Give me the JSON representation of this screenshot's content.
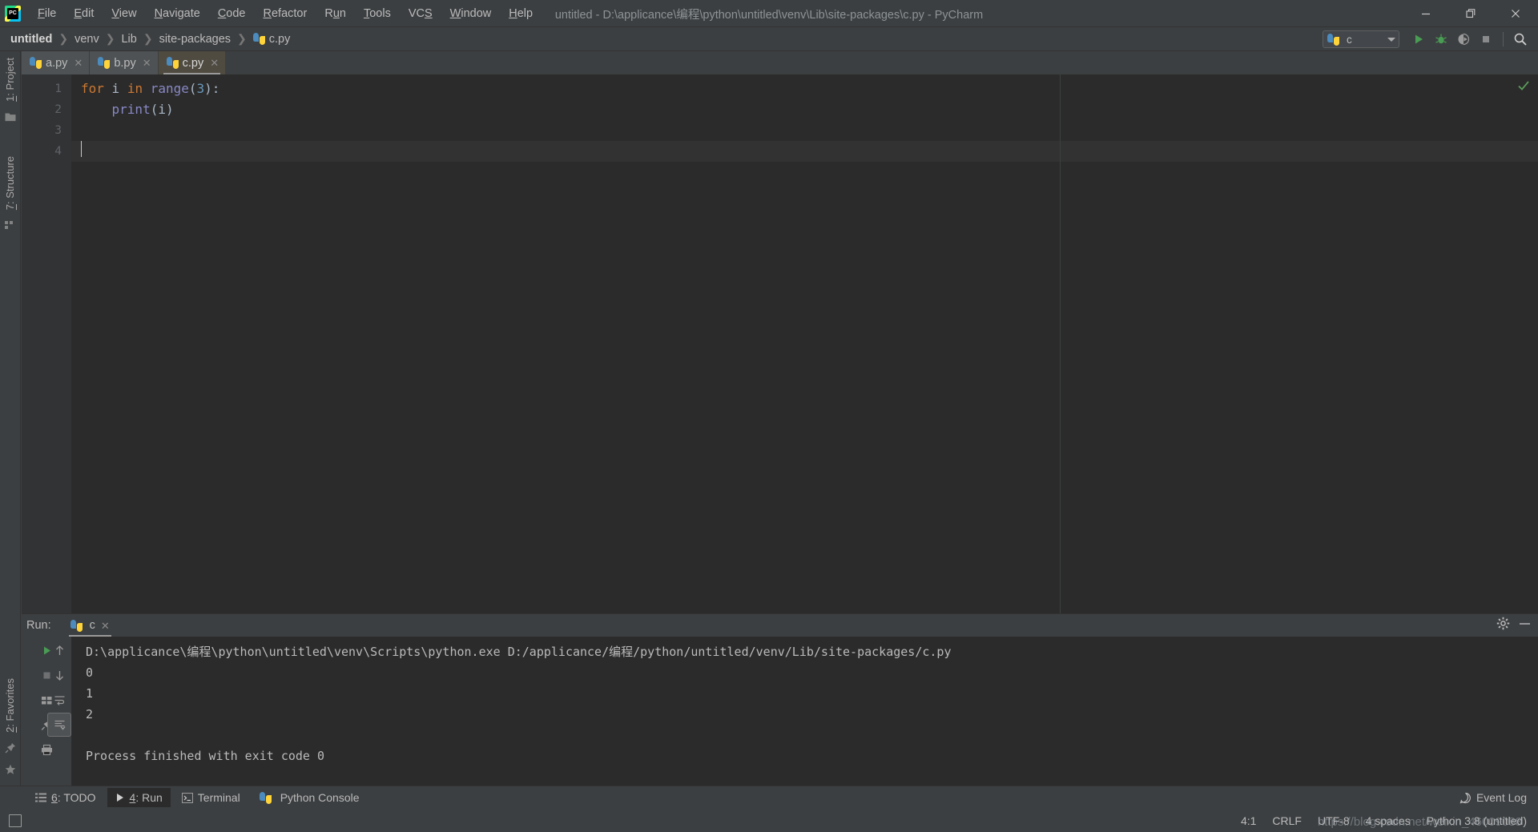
{
  "window": {
    "title": "untitled - D:\\applicance\\编程\\python\\untitled\\venv\\Lib\\site-packages\\c.py - PyCharm",
    "logo_text": "PC",
    "minimize": "—",
    "maximize": "❐",
    "close": "✕"
  },
  "menubar": {
    "items": [
      {
        "label": "File",
        "mnemonic": "F"
      },
      {
        "label": "Edit",
        "mnemonic": "E"
      },
      {
        "label": "View",
        "mnemonic": "V"
      },
      {
        "label": "Navigate",
        "mnemonic": "N"
      },
      {
        "label": "Code",
        "mnemonic": "C"
      },
      {
        "label": "Refactor",
        "mnemonic": "R"
      },
      {
        "label": "Run",
        "mnemonic": "u"
      },
      {
        "label": "Tools",
        "mnemonic": "T"
      },
      {
        "label": "VCS",
        "mnemonic": "S"
      },
      {
        "label": "Window",
        "mnemonic": "W"
      },
      {
        "label": "Help",
        "mnemonic": "H"
      }
    ]
  },
  "breadcrumb": {
    "separator": "❯",
    "items": [
      "untitled",
      "venv",
      "Lib",
      "site-packages",
      "c.py"
    ]
  },
  "toolbar": {
    "run_config": "c",
    "run_button": "run-icon",
    "debug_button": "debug-icon",
    "coverage_button": "run-with-coverage-icon",
    "stop_button": "stop-icon",
    "search_button": "search-icon"
  },
  "left_stripe": {
    "project_label": "1: Project",
    "structure_label": "7: Structure",
    "favorites_label": "2: Favorites"
  },
  "editor": {
    "tabs": [
      {
        "label": "a.py",
        "active": false
      },
      {
        "label": "b.py",
        "active": false
      },
      {
        "label": "c.py",
        "active": true
      }
    ],
    "line_numbers": [
      "1",
      "2",
      "3",
      "4"
    ],
    "code": [
      {
        "tokens": [
          {
            "t": "for",
            "c": "kw"
          },
          {
            "t": " i ",
            "c": "punc"
          },
          {
            "t": "in",
            "c": "kw"
          },
          {
            "t": " ",
            "c": "punc"
          },
          {
            "t": "range",
            "c": "builtin"
          },
          {
            "t": "(",
            "c": "punc"
          },
          {
            "t": "3",
            "c": "num"
          },
          {
            "t": "):",
            "c": "punc"
          }
        ]
      },
      {
        "tokens": [
          {
            "t": "    ",
            "c": "punc"
          },
          {
            "t": "print",
            "c": "builtin"
          },
          {
            "t": "(i)",
            "c": "punc"
          }
        ]
      },
      {
        "tokens": []
      },
      {
        "tokens": []
      }
    ]
  },
  "run_window": {
    "label": "Run:",
    "tab_name": "c",
    "settings_icon": "gear-icon",
    "minimize_icon": "minimize-icon",
    "sidebar_buttons": [
      "rerun-icon",
      "stop-icon",
      "up-arrow-icon",
      "down-arrow-icon",
      "print-icon",
      "soft-wrap-icon",
      "scroll-to-end-icon",
      "print-output-icon"
    ],
    "console_lines": [
      "D:\\applicance\\编程\\python\\untitled\\venv\\Scripts\\python.exe D:/applicance/编程/python/untitled/venv/Lib/site-packages/c.py",
      "0",
      "1",
      "2",
      "",
      "Process finished with exit code 0"
    ]
  },
  "bottom_bar": {
    "items": [
      {
        "label": "6: TODO",
        "mnemonic": "6",
        "icon": "todo-icon",
        "active": false
      },
      {
        "label": "4: Run",
        "mnemonic": "4",
        "icon": "run-icon",
        "active": true
      },
      {
        "label": "Terminal",
        "mnemonic": "",
        "icon": "terminal-icon",
        "active": false
      },
      {
        "label": "Python Console",
        "mnemonic": "",
        "icon": "python-icon",
        "active": false
      }
    ],
    "event_log": "Event Log"
  },
  "status_bar": {
    "caret_position": "4:1",
    "line_separator": "CRLF",
    "encoding": "UTF-8",
    "indent": "4 spaces",
    "interpreter": "Python 3.8 (untitled)",
    "watermark": "https://blog.csdn.net/weixin_46009088"
  },
  "colors": {
    "accent_green": "#499c54",
    "keyword_orange": "#cc7832",
    "number_blue": "#6897bb",
    "builtin_purple": "#8888c6",
    "editor_bg": "#2b2b2b",
    "chrome_bg": "#3c3f41"
  }
}
